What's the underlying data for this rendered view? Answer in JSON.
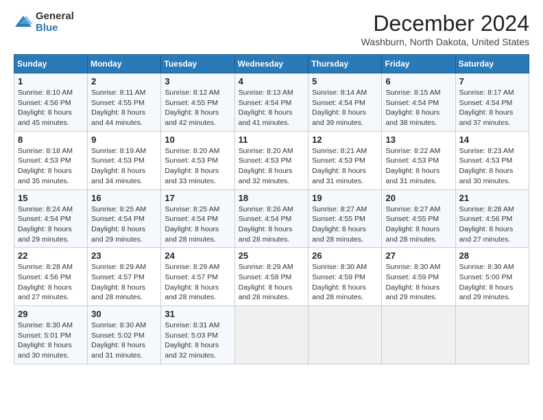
{
  "logo": {
    "general": "General",
    "blue": "Blue"
  },
  "header": {
    "month": "December 2024",
    "location": "Washburn, North Dakota, United States"
  },
  "weekdays": [
    "Sunday",
    "Monday",
    "Tuesday",
    "Wednesday",
    "Thursday",
    "Friday",
    "Saturday"
  ],
  "weeks": [
    [
      {
        "day": "1",
        "sunrise": "8:10 AM",
        "sunset": "4:56 PM",
        "daylight": "8 hours and 45 minutes."
      },
      {
        "day": "2",
        "sunrise": "8:11 AM",
        "sunset": "4:55 PM",
        "daylight": "8 hours and 44 minutes."
      },
      {
        "day": "3",
        "sunrise": "8:12 AM",
        "sunset": "4:55 PM",
        "daylight": "8 hours and 42 minutes."
      },
      {
        "day": "4",
        "sunrise": "8:13 AM",
        "sunset": "4:54 PM",
        "daylight": "8 hours and 41 minutes."
      },
      {
        "day": "5",
        "sunrise": "8:14 AM",
        "sunset": "4:54 PM",
        "daylight": "8 hours and 39 minutes."
      },
      {
        "day": "6",
        "sunrise": "8:15 AM",
        "sunset": "4:54 PM",
        "daylight": "8 hours and 38 minutes."
      },
      {
        "day": "7",
        "sunrise": "8:17 AM",
        "sunset": "4:54 PM",
        "daylight": "8 hours and 37 minutes."
      }
    ],
    [
      {
        "day": "8",
        "sunrise": "8:18 AM",
        "sunset": "4:53 PM",
        "daylight": "8 hours and 35 minutes."
      },
      {
        "day": "9",
        "sunrise": "8:19 AM",
        "sunset": "4:53 PM",
        "daylight": "8 hours and 34 minutes."
      },
      {
        "day": "10",
        "sunrise": "8:20 AM",
        "sunset": "4:53 PM",
        "daylight": "8 hours and 33 minutes."
      },
      {
        "day": "11",
        "sunrise": "8:20 AM",
        "sunset": "4:53 PM",
        "daylight": "8 hours and 32 minutes."
      },
      {
        "day": "12",
        "sunrise": "8:21 AM",
        "sunset": "4:53 PM",
        "daylight": "8 hours and 31 minutes."
      },
      {
        "day": "13",
        "sunrise": "8:22 AM",
        "sunset": "4:53 PM",
        "daylight": "8 hours and 31 minutes."
      },
      {
        "day": "14",
        "sunrise": "8:23 AM",
        "sunset": "4:53 PM",
        "daylight": "8 hours and 30 minutes."
      }
    ],
    [
      {
        "day": "15",
        "sunrise": "8:24 AM",
        "sunset": "4:54 PM",
        "daylight": "8 hours and 29 minutes."
      },
      {
        "day": "16",
        "sunrise": "8:25 AM",
        "sunset": "4:54 PM",
        "daylight": "8 hours and 29 minutes."
      },
      {
        "day": "17",
        "sunrise": "8:25 AM",
        "sunset": "4:54 PM",
        "daylight": "8 hours and 28 minutes."
      },
      {
        "day": "18",
        "sunrise": "8:26 AM",
        "sunset": "4:54 PM",
        "daylight": "8 hours and 28 minutes."
      },
      {
        "day": "19",
        "sunrise": "8:27 AM",
        "sunset": "4:55 PM",
        "daylight": "8 hours and 28 minutes."
      },
      {
        "day": "20",
        "sunrise": "8:27 AM",
        "sunset": "4:55 PM",
        "daylight": "8 hours and 28 minutes."
      },
      {
        "day": "21",
        "sunrise": "8:28 AM",
        "sunset": "4:56 PM",
        "daylight": "8 hours and 27 minutes."
      }
    ],
    [
      {
        "day": "22",
        "sunrise": "8:28 AM",
        "sunset": "4:56 PM",
        "daylight": "8 hours and 27 minutes."
      },
      {
        "day": "23",
        "sunrise": "8:29 AM",
        "sunset": "4:57 PM",
        "daylight": "8 hours and 28 minutes."
      },
      {
        "day": "24",
        "sunrise": "8:29 AM",
        "sunset": "4:57 PM",
        "daylight": "8 hours and 28 minutes."
      },
      {
        "day": "25",
        "sunrise": "8:29 AM",
        "sunset": "4:58 PM",
        "daylight": "8 hours and 28 minutes."
      },
      {
        "day": "26",
        "sunrise": "8:30 AM",
        "sunset": "4:59 PM",
        "daylight": "8 hours and 28 minutes."
      },
      {
        "day": "27",
        "sunrise": "8:30 AM",
        "sunset": "4:59 PM",
        "daylight": "8 hours and 29 minutes."
      },
      {
        "day": "28",
        "sunrise": "8:30 AM",
        "sunset": "5:00 PM",
        "daylight": "8 hours and 29 minutes."
      }
    ],
    [
      {
        "day": "29",
        "sunrise": "8:30 AM",
        "sunset": "5:01 PM",
        "daylight": "8 hours and 30 minutes."
      },
      {
        "day": "30",
        "sunrise": "8:30 AM",
        "sunset": "5:02 PM",
        "daylight": "8 hours and 31 minutes."
      },
      {
        "day": "31",
        "sunrise": "8:31 AM",
        "sunset": "5:03 PM",
        "daylight": "8 hours and 32 minutes."
      },
      null,
      null,
      null,
      null
    ]
  ],
  "labels": {
    "sunrise": "Sunrise:",
    "sunset": "Sunset:",
    "daylight": "Daylight:"
  }
}
